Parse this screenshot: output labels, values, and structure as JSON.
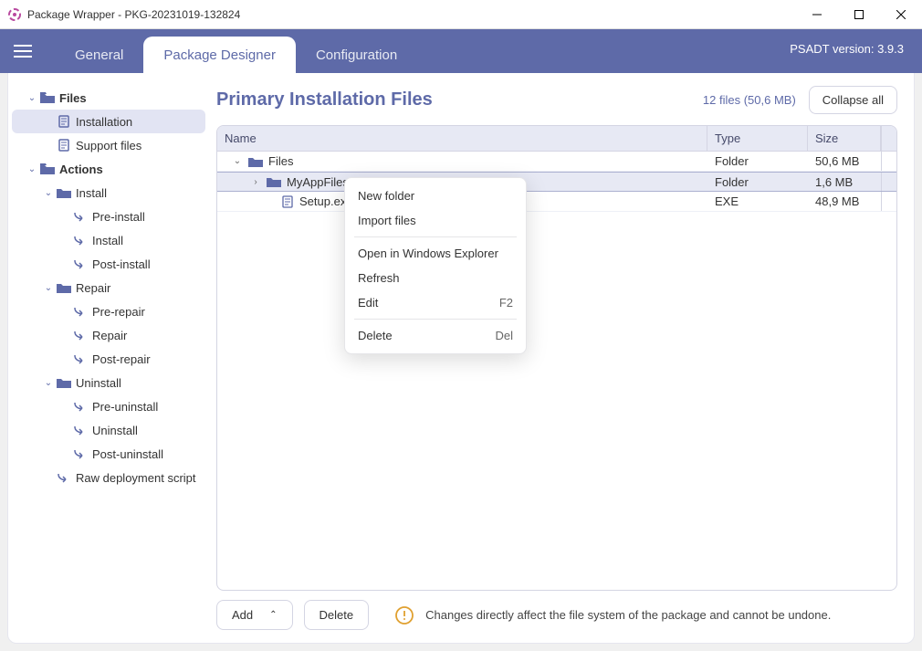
{
  "window": {
    "title": "Package Wrapper - PKG-20231019-132824"
  },
  "toolbar": {
    "tabs": {
      "general": "General",
      "designer": "Package Designer",
      "config": "Configuration"
    },
    "version": "PSADT version: 3.9.3"
  },
  "sidebar": {
    "files": {
      "label": "Files",
      "installation": "Installation",
      "support": "Support files"
    },
    "actions": {
      "label": "Actions",
      "install": {
        "label": "Install",
        "pre": "Pre-install",
        "main": "Install",
        "post": "Post-install"
      },
      "repair": {
        "label": "Repair",
        "pre": "Pre-repair",
        "main": "Repair",
        "post": "Post-repair"
      },
      "uninstall": {
        "label": "Uninstall",
        "pre": "Pre-uninstall",
        "main": "Uninstall",
        "post": "Post-uninstall"
      },
      "raw": "Raw deployment script"
    }
  },
  "main": {
    "title": "Primary Installation Files",
    "summary": "12 files (50,6 MB)",
    "collapse": "Collapse all",
    "columns": {
      "name": "Name",
      "type": "Type",
      "size": "Size"
    },
    "rows": [
      {
        "name": "Files",
        "type": "Folder",
        "size": "50,6 MB"
      },
      {
        "name": "MyAppFiles1",
        "type": "Folder",
        "size": "1,6 MB"
      },
      {
        "name": "Setup.exe",
        "type": "EXE",
        "size": "48,9 MB"
      }
    ]
  },
  "footer": {
    "add": "Add",
    "delete": "Delete",
    "warning": "Changes directly affect the file system of the package and cannot be undone."
  },
  "ctx": {
    "newFolder": "New folder",
    "import": "Import files",
    "openExplorer": "Open in Windows Explorer",
    "refresh": "Refresh",
    "edit": "Edit",
    "editKey": "F2",
    "delete": "Delete",
    "deleteKey": "Del"
  }
}
